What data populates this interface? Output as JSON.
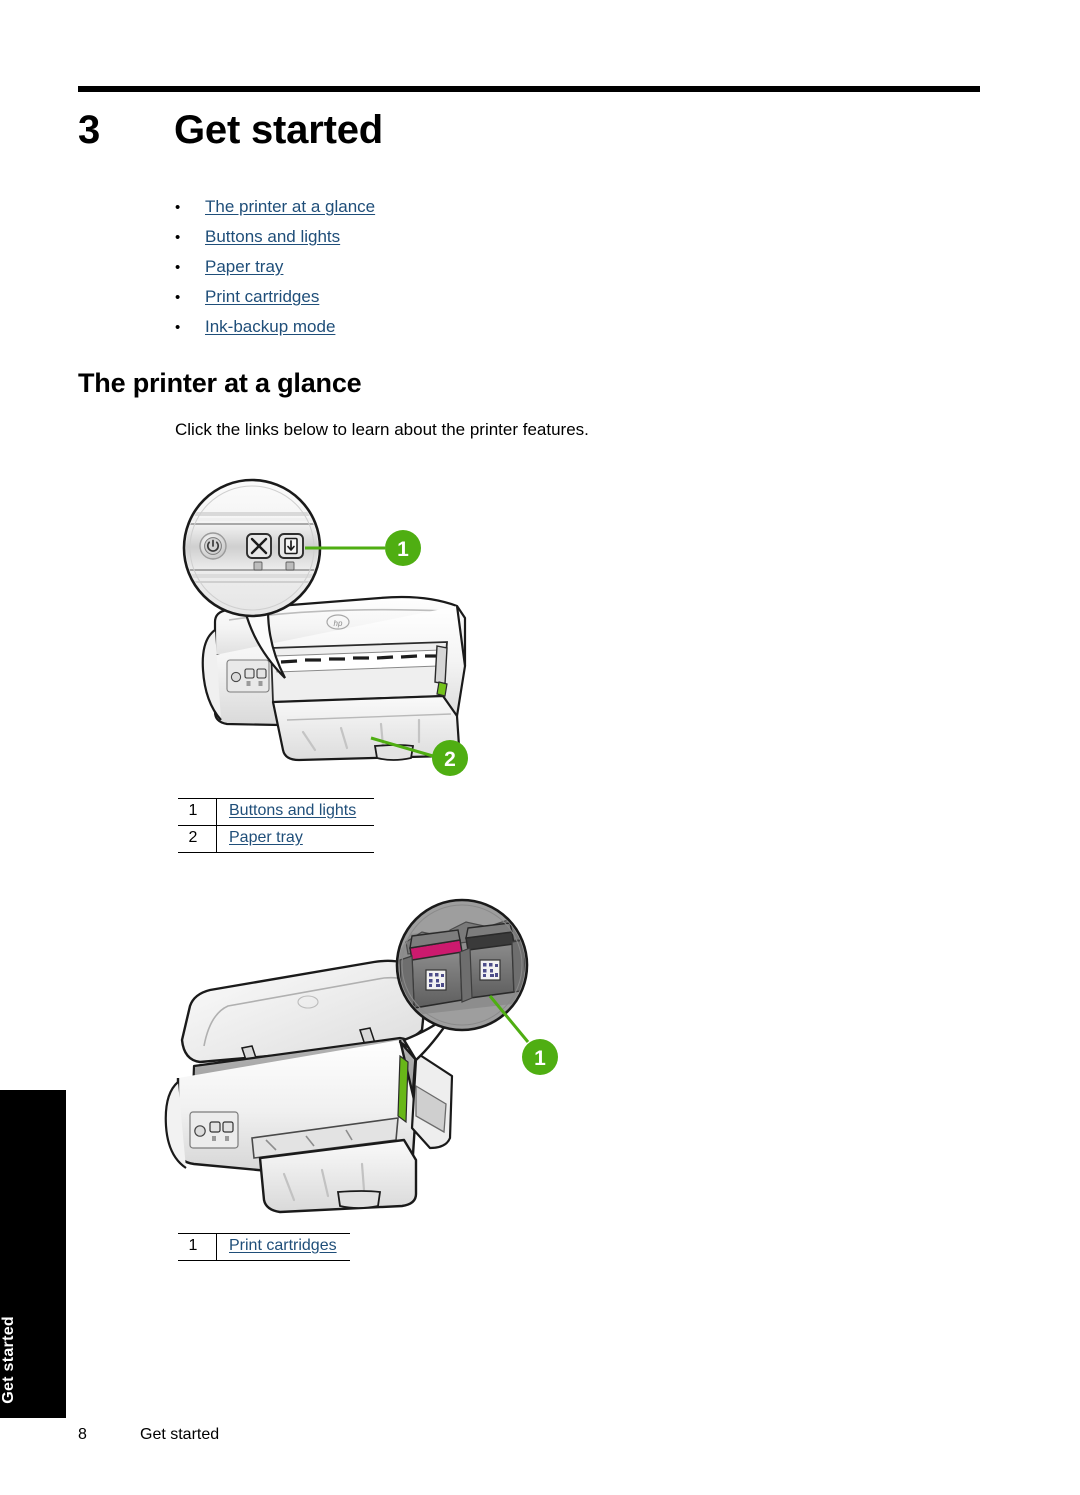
{
  "page": {
    "chapter_number": "3",
    "chapter_title": "Get started",
    "side_tab_label": "Get started",
    "footer_page_number": "8",
    "footer_chapter_label": "Get started"
  },
  "toc": {
    "bullet_glyph": "•",
    "items": [
      {
        "label": "The printer at a glance"
      },
      {
        "label": "Buttons and lights"
      },
      {
        "label": "Paper tray"
      },
      {
        "label": "Print cartridges"
      },
      {
        "label": "Ink-backup mode"
      }
    ]
  },
  "section": {
    "heading": "The printer at a glance",
    "intro": "Click the links below to learn about the printer features."
  },
  "figure_front": {
    "callouts": [
      {
        "number": "1"
      },
      {
        "number": "2"
      }
    ],
    "magnifier_detail": "printer-control-panel",
    "control_panel_icons": [
      "power-icon",
      "cancel-icon",
      "resume-icon"
    ],
    "brand_mark": "hp"
  },
  "legend_front": {
    "rows": [
      {
        "number": "1",
        "label": "Buttons and lights"
      },
      {
        "number": "2",
        "label": "Paper tray"
      }
    ]
  },
  "figure_open": {
    "callouts": [
      {
        "number": "1"
      }
    ],
    "magnifier_detail": "print-cartridge-cradle",
    "cartridges": [
      {
        "name": "tri-color-cartridge",
        "accent_color": "#cc1a6e"
      },
      {
        "name": "black-cartridge",
        "accent_color": "#3a3a3a"
      }
    ]
  },
  "legend_open": {
    "rows": [
      {
        "number": "1",
        "label": "Print cartridges"
      }
    ]
  },
  "colors": {
    "link": "#1f4e79",
    "callout_green": "#4fae12",
    "rule_black": "#000000",
    "magnifier_gray": "#9e9e9e"
  }
}
